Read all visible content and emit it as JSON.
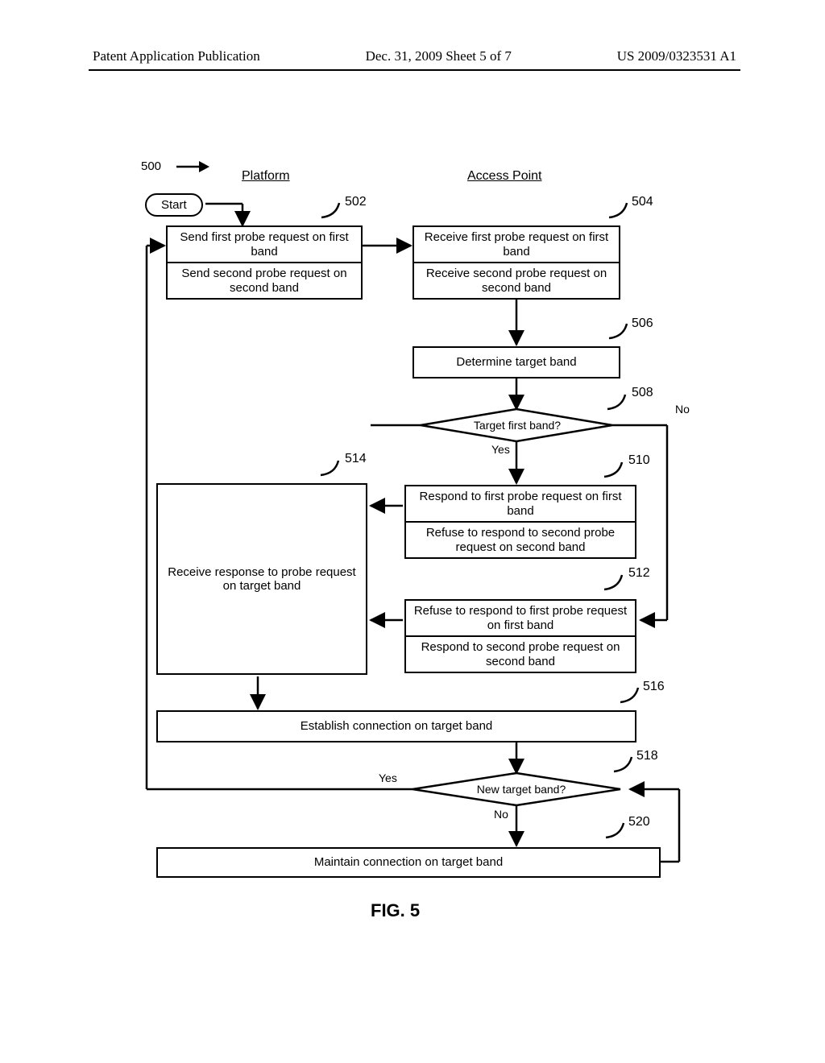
{
  "header": {
    "left": "Patent Application Publication",
    "center": "Dec. 31, 2009  Sheet 5 of 7",
    "right": "US 2009/0323531 A1"
  },
  "lanes": {
    "platform": "Platform",
    "access_point": "Access Point"
  },
  "fig_num": "500",
  "start": "Start",
  "refs": {
    "r502": "502",
    "r504": "504",
    "r506": "506",
    "r508": "508",
    "r510": "510",
    "r512": "512",
    "r514": "514",
    "r516": "516",
    "r518": "518",
    "r520": "520"
  },
  "boxes": {
    "b502a": "Send first probe request on first band",
    "b502b": "Send second probe request on second band",
    "b504a": "Receive first probe request on first band",
    "b504b": "Receive second probe request on second band",
    "b506": "Determine target band",
    "d508": "Target first band?",
    "d508yes": "Yes",
    "d508no": "No",
    "b510a": "Respond to first probe request on first band",
    "b510b": "Refuse to respond to second probe request on second band",
    "b512a": "Refuse to respond to first probe request on first band",
    "b512b": "Respond to second probe request on second band",
    "b514": "Receive response to probe request on target band",
    "b516": "Establish connection on target band",
    "d518": "New target band?",
    "d518yes": "Yes",
    "d518no": "No",
    "b520": "Maintain connection on target band"
  },
  "figure_caption": "FIG. 5"
}
